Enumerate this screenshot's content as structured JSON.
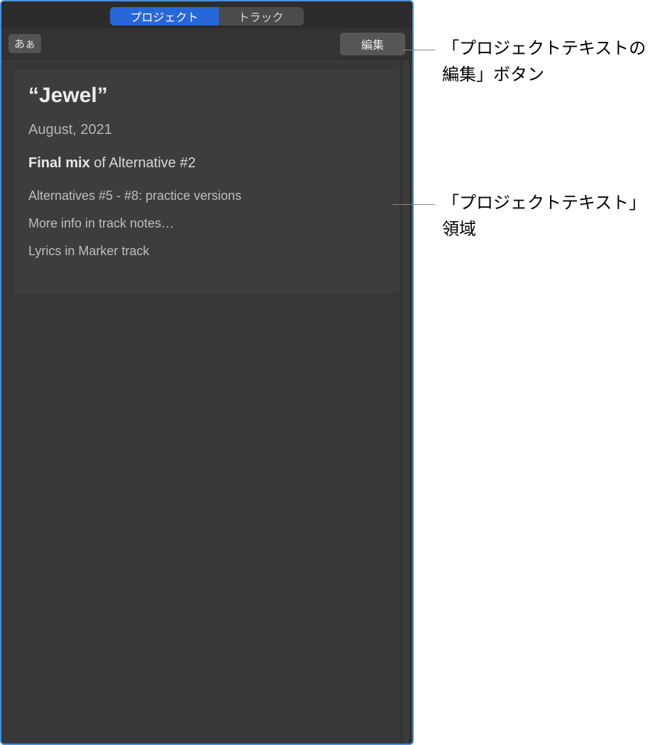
{
  "tabs": {
    "project": "プロジェクト",
    "track": "トラック"
  },
  "toolbar": {
    "font_button": "あぁ",
    "edit_button": "編集"
  },
  "notes": {
    "title": "“Jewel”",
    "date": "August, 2021",
    "mix_bold": "Final mix",
    "mix_rest": " of Alternative #2",
    "line_alt": "Alternatives #5 - #8: practice versions",
    "line_more": "More info in track notes…",
    "line_lyrics": "Lyrics in Marker track"
  },
  "callouts": {
    "edit_button": "「プロジェクトテキストの編集」ボタン",
    "text_area": "「プロジェクトテキスト」領域"
  }
}
